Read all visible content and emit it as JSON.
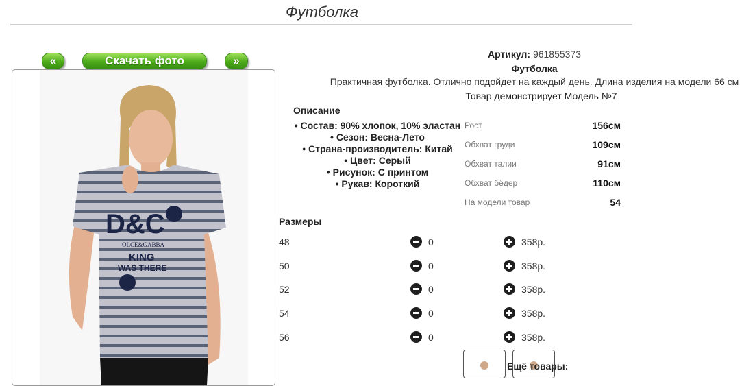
{
  "header": {
    "title": "Футболка"
  },
  "gallery": {
    "prev_label": "«",
    "download_label": "Скачать фото",
    "next_label": "»",
    "print_text": {
      "brand": "D&C",
      "sub": "OLCE&GABBA",
      "line1": "KING",
      "line2": "WAS THERE"
    }
  },
  "product": {
    "article_label": "Артикул:",
    "article_value": "961855373",
    "name": "Футболка",
    "description": "Практичная футболка. Отлично подойдет на каждый день. Длина изделия на модели 66 см",
    "model_text": "Товар демонстрирует Модель №7"
  },
  "description_block": {
    "heading": "Описание",
    "items": [
      "• Состав: 90% хлопок, 10% эластан",
      "• Сезон: Весна-Лето",
      "• Страна-производитель: Китай",
      "• Цвет: Серый",
      "• Рисунок: С принтом",
      "• Рукав: Короткий"
    ]
  },
  "model_params": [
    {
      "label": "Рост",
      "value": "156см"
    },
    {
      "label": "Обхват груди",
      "value": "109см"
    },
    {
      "label": "Обхват талии",
      "value": "91см"
    },
    {
      "label": "Обхват бёдер",
      "value": "110см"
    },
    {
      "label": "На модели товар",
      "value": "54"
    }
  ],
  "sizes": {
    "heading": "Размеры",
    "rows": [
      {
        "size": "48",
        "qty": "0",
        "price": "358р."
      },
      {
        "size": "50",
        "qty": "0",
        "price": "358р."
      },
      {
        "size": "52",
        "qty": "0",
        "price": "358р."
      },
      {
        "size": "54",
        "qty": "0",
        "price": "358р."
      },
      {
        "size": "56",
        "qty": "0",
        "price": "358р."
      }
    ]
  },
  "more": {
    "label": "Ещё товары:"
  },
  "colors": {
    "accent_green": "#4cab1a",
    "shirt_gray": "#b7b7c2",
    "print_navy": "#1d2547"
  }
}
